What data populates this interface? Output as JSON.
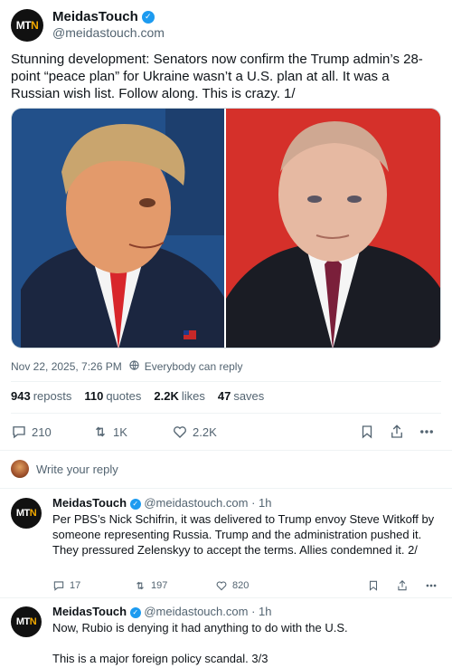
{
  "post": {
    "author_name": "MeidasTouch",
    "author_handle": "@meidastouch.com",
    "avatar_text_a": "MT",
    "avatar_text_b": "N",
    "text": "Stunning development: Senators now confirm the Trump admin’s 28-point “peace plan” for Ukraine wasn’t a U.S. plan at all. It was a Russian wish list. Follow along. This is crazy. 1/",
    "timestamp": "Nov 22, 2025, 7:26 PM",
    "audience": "Everybody can reply",
    "stats": {
      "reposts_count": "943",
      "reposts_label": "reposts",
      "quotes_count": "110",
      "quotes_label": "quotes",
      "likes_count": "2.2K",
      "likes_label": "likes",
      "saves_count": "47",
      "saves_label": "saves"
    },
    "actions": {
      "replies": "210",
      "reposts": "1K",
      "likes": "2.2K"
    }
  },
  "reply_prompt": "Write your reply",
  "replies": [
    {
      "author_name": "MeidasTouch",
      "author_handle": "@meidastouch.com",
      "time": "· 1h",
      "text": "Per PBS’s Nick Schifrin, it was delivered to Trump envoy Steve Witkoff by someone representing Russia. Trump and the administration pushed it. They pressured Zelenskyy to accept the terms. Allies condemned it. 2/",
      "replies": "17",
      "reposts": "197",
      "likes": "820"
    },
    {
      "author_name": "MeidasTouch",
      "author_handle": "@meidastouch.com",
      "time": "· 1h",
      "text_line1": "Now, Rubio is denying it had anything to do with the U.S.",
      "text_line2": "This is a major foreign policy scandal. 3/3"
    }
  ],
  "colors": {
    "accent": "#1d9bf0",
    "muted": "#536471",
    "text": "#0f1419"
  }
}
